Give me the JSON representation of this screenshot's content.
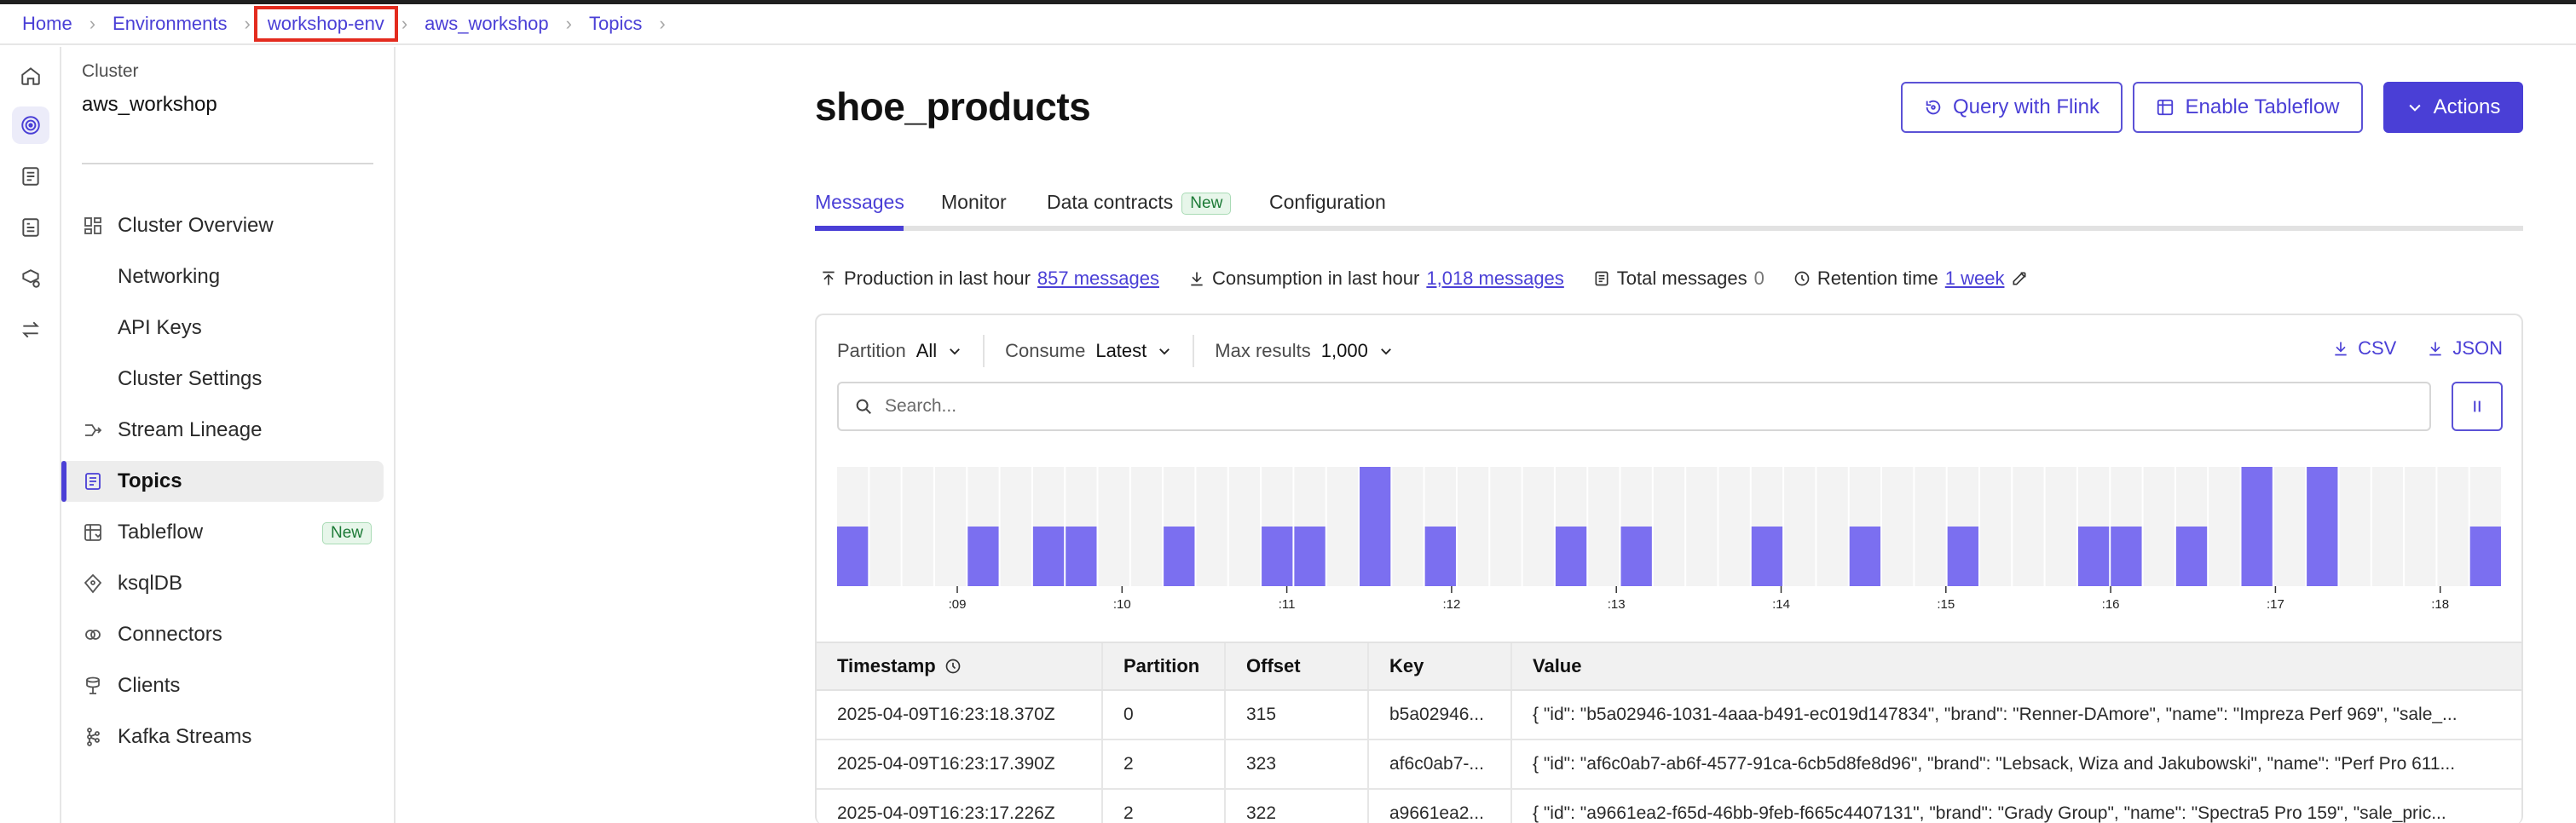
{
  "breadcrumb": [
    "Home",
    "Environments",
    "workshop-env",
    "aws_workshop",
    "Topics"
  ],
  "rail": [
    "home-icon",
    "environments-icon",
    "topics-icon",
    "schema-icon",
    "marketplace-icon",
    "data-transfer-icon"
  ],
  "nav": {
    "cluster_label": "Cluster",
    "cluster_name": "aws_workshop",
    "items": [
      {
        "label": "Cluster Overview"
      },
      {
        "label": "Networking"
      },
      {
        "label": "API Keys"
      },
      {
        "label": "Cluster Settings"
      },
      {
        "label": "Stream Lineage"
      },
      {
        "label": "Topics"
      },
      {
        "label": "Tableflow",
        "badge": "New"
      },
      {
        "label": "ksqlDB"
      },
      {
        "label": "Connectors"
      },
      {
        "label": "Clients"
      },
      {
        "label": "Kafka Streams"
      }
    ]
  },
  "header": {
    "title": "shoe_products",
    "query_flink": "Query with Flink",
    "enable_tableflow": "Enable Tableflow",
    "actions": "Actions"
  },
  "tabs": [
    {
      "label": "Messages"
    },
    {
      "label": "Monitor"
    },
    {
      "label": "Data contracts",
      "badge": "New"
    },
    {
      "label": "Configuration"
    }
  ],
  "stats": {
    "production_label": "Production in last hour",
    "production_value": "857 messages",
    "consumption_label": "Consumption in last hour",
    "consumption_value": "1,018 messages",
    "total_label": "Total messages",
    "total_value": "0",
    "retention_label": "Retention time",
    "retention_value": "1 week"
  },
  "filters": {
    "partition_label": "Partition",
    "partition_value": "All",
    "consume_label": "Consume",
    "consume_value": "Latest",
    "max_label": "Max results",
    "max_value": "1,000",
    "csv": "CSV",
    "json": "JSON"
  },
  "search": {
    "placeholder": "Search..."
  },
  "histogram": {
    "tick_labels": [
      ":09",
      ":10",
      ":11",
      ":12",
      ":13",
      ":14",
      ":15",
      ":16",
      ":17",
      ":18"
    ],
    "bars": [
      1,
      0,
      0,
      0,
      1,
      0,
      1,
      1,
      0,
      0,
      1,
      0,
      0,
      1,
      1,
      0,
      2,
      0,
      1,
      0,
      0,
      0,
      1,
      0,
      1,
      0,
      0,
      0,
      1,
      0,
      0,
      1,
      0,
      0,
      1,
      0,
      0,
      0,
      1,
      1,
      0,
      1,
      0,
      2,
      0,
      2,
      0,
      0,
      0,
      0,
      1
    ],
    "colors": {
      "bar": "#7b6ff0",
      "bg": "#f3f3f3"
    }
  },
  "table": {
    "headers": [
      "Timestamp",
      "Partition",
      "Offset",
      "Key",
      "Value"
    ],
    "rows": [
      [
        "2025-04-09T16:23:18.370Z",
        "0",
        "315",
        "b5a02946...",
        "{ \"id\": \"b5a02946-1031-4aaa-b491-ec019d147834\", \"brand\": \"Renner-DAmore\", \"name\": \"Impreza Perf 969\", \"sale_..."
      ],
      [
        "2025-04-09T16:23:17.390Z",
        "2",
        "323",
        "af6c0ab7-...",
        "{ \"id\": \"af6c0ab7-ab6f-4577-91ca-6cb5d8fe8d96\", \"brand\": \"Lebsack, Wiza and Jakubowski\", \"name\": \"Perf Pro 611..."
      ],
      [
        "2025-04-09T16:23:17.226Z",
        "2",
        "322",
        "a9661ea2...",
        "{ \"id\": \"a9661ea2-f65d-46bb-9feb-f665c4407131\", \"brand\": \"Grady Group\", \"name\": \"Spectra5 Pro 159\", \"sale_pric..."
      ]
    ]
  },
  "colors": {
    "accent": "#4a3fd6",
    "highlight": "#e32b1e"
  }
}
